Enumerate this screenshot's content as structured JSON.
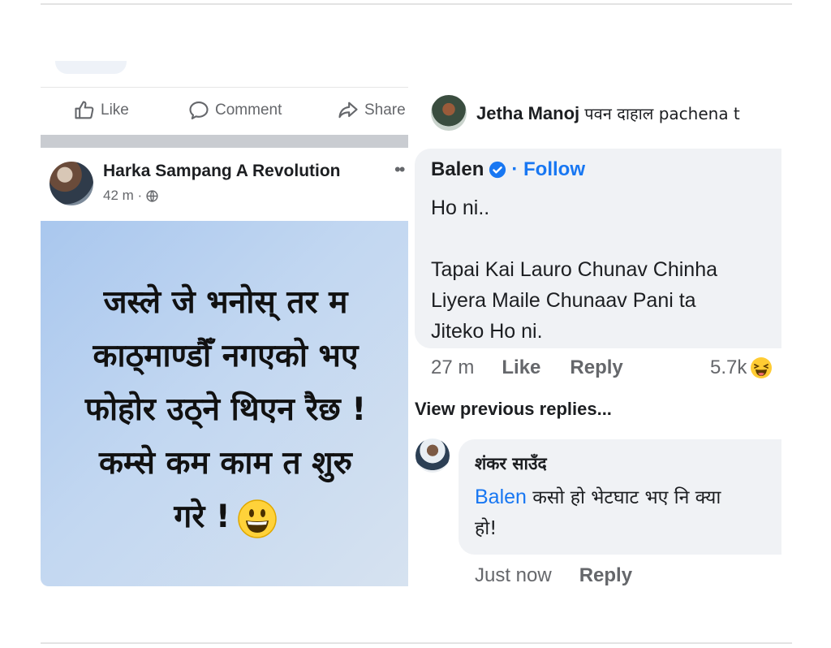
{
  "left_post": {
    "actions": {
      "like": "Like",
      "comment": "Comment",
      "share": "Share"
    },
    "author": "Harka Sampang A Revolution",
    "time": "42 m ·",
    "body_lines": [
      "जस्ले जे भनोस् तर म",
      "काठ्माण्डौँ नगएको भए",
      "फोहोर उठ्ने थिएन रैछ !",
      "कम्से कम काम त शुरु",
      "गरे !"
    ],
    "emoji_icon": "grinning-face-icon"
  },
  "comments": {
    "jetha": {
      "name": "Jetha Manoj",
      "text": "पवन दाहाल pachena t"
    },
    "balen": {
      "name": "Balen",
      "follow": "· Follow",
      "text": "Ho ni..\n\nTapai Kai Lauro Chunav Chinha\nLiyera Maile Chunaav Pani ta\nJiteko Ho ni.",
      "time": "27 m",
      "like": "Like",
      "reply": "Reply",
      "reactions": "5.7k"
    },
    "view_previous": "View previous replies...",
    "shankar": {
      "name": "शंकर साउँद",
      "mention": "Balen",
      "text_line1": "कसो हो भेटघाट भए नि क्या",
      "text_line2": "हो!",
      "time": "Just now",
      "reply": "Reply"
    }
  },
  "colors": {
    "link_blue": "#1877f2",
    "meta_gray": "#65676b",
    "bubble_bg": "#f0f2f5"
  }
}
